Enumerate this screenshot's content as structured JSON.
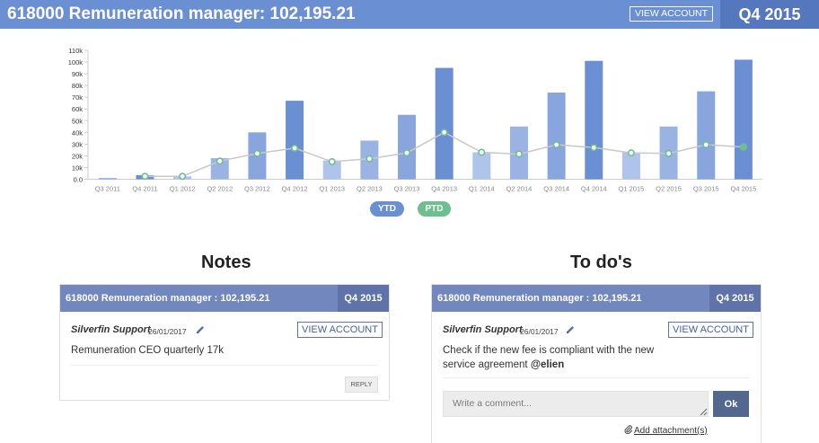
{
  "header": {
    "title": "618000 Remuneration manager: 102,195.21",
    "view_account_label": "VIEW ACCOUNT",
    "period": "Q4 2015"
  },
  "colors": {
    "header_bg": "#6b8fd3",
    "header_period_bg": "#5477bd",
    "ytd_bar": "#6b8fd3",
    "ptd_point": "#6dbf8f",
    "panel_head_bg": "#7387bf",
    "panel_head_period_bg": "#5f72aa",
    "ok_button": "#54688f"
  },
  "chart_data": {
    "type": "bar",
    "categories": [
      "Q3 2011",
      "Q4 2011",
      "Q1 2012",
      "Q2 2012",
      "Q3 2012",
      "Q4 2012",
      "Q1 2013",
      "Q2 2013",
      "Q3 2013",
      "Q4 2013",
      "Q1 2014",
      "Q2 2014",
      "Q3 2014",
      "Q4 2014",
      "Q1 2015",
      "Q2 2015",
      "Q3 2015",
      "Q4 2015"
    ],
    "series": [
      {
        "name": "YTD",
        "type": "bar",
        "values": [
          1,
          3.5,
          2.5,
          18,
          40,
          67,
          16,
          33,
          55,
          95,
          23,
          45,
          74,
          101,
          23,
          45,
          75,
          102
        ]
      },
      {
        "name": "PTD",
        "type": "line",
        "values": [
          null,
          2.5,
          2.5,
          15.5,
          22,
          26.5,
          15,
          17.5,
          22.5,
          40,
          23,
          21.5,
          29.5,
          27,
          22.5,
          22,
          29.5,
          27.5
        ]
      }
    ],
    "y_tick_labels": [
      "0.0",
      "10k",
      "20k",
      "30k",
      "40k",
      "50k",
      "60k",
      "70k",
      "80k",
      "90k",
      "100k",
      "110k"
    ],
    "ylim": [
      0,
      110
    ],
    "y_unit": "k",
    "grid": false,
    "legend_placement": "bottom-center"
  },
  "legend": {
    "ytd_label": "YTD",
    "ptd_label": "PTD"
  },
  "notes": {
    "section_title": "Notes",
    "account_title": "618000 Remuneration manager : 102,195.21",
    "period": "Q4 2015",
    "author": "Silverfin Support",
    "date": "26/01/2017",
    "view_account_label": "VIEW ACCOUNT",
    "text": "Remuneration CEO quarterly 17k",
    "reply_label": "REPLY"
  },
  "todos": {
    "section_title": "To do's",
    "account_title": "618000 Remuneration manager : 102,195.21",
    "period": "Q4 2015",
    "author": "Silverfin Support",
    "date": "26/01/2017",
    "view_account_label": "VIEW ACCOUNT",
    "text_line1": "Check if the new fee is compliant with the new",
    "text_line2_prefix": "service agreement",
    "mention": "@elien",
    "comment_placeholder": "Write a comment...",
    "ok_label": "Ok",
    "attachment_label": "Add attachment(s)"
  },
  "icons": {
    "edit": "pencil-icon",
    "attachment": "paperclip-icon",
    "resize": "resize-handle-icon"
  }
}
